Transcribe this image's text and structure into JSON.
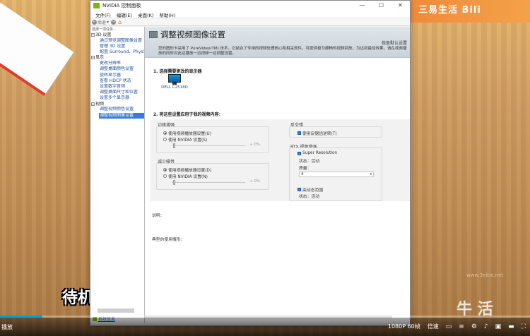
{
  "video": {
    "channel_logo": "三易生活 Bili",
    "subtitle": "待机",
    "watermark": "牛 活",
    "watermark_url": "www.3eitie.net",
    "progress_fraction": 0.08,
    "left_label": "播放",
    "quality": "1080P 60帧",
    "speed": "倍速",
    "icons": [
      "subtitle-icon",
      "danmaku-icon",
      "settings-icon",
      "volume-icon",
      "pip-icon",
      "widescreen-icon",
      "fullscreen-icon"
    ]
  },
  "window": {
    "title": "NVIDIA 控制面板",
    "buttons": [
      "—",
      "☐",
      "✕"
    ],
    "menu": [
      "文件(F)",
      "编辑(E)",
      "桌面(K)",
      "帮助(H)"
    ],
    "toolbar": {
      "back": "后退",
      "forward": "→",
      "home": "⌂"
    }
  },
  "tree": {
    "header": "选择一项任务...",
    "categories": [
      {
        "label": "3D 设置",
        "items": [
          "通过预览调整图像设置",
          "管理 3D 设置",
          "配置 Surround、PhysX"
        ]
      },
      {
        "label": "显示",
        "items": [
          "更改分辨率",
          "调整桌面颜色设置",
          "旋转显示器",
          "查看 HDCP 状态",
          "设置数字音频",
          "调整桌面尺寸和位置",
          "设置多个显示器"
        ]
      },
      {
        "label": "视频",
        "items": [
          "调整视频颜色设置",
          "调整视频图像设置"
        ]
      }
    ],
    "selected": "调整视频图像设置",
    "system_info": "系统信息"
  },
  "content": {
    "title": "调整视频图像设置",
    "restore_defaults": "恢复默认设置",
    "description": "您的图形卡采用了 PureVideo(TM) 技术，它结合了专用的视频处理核心和相关软件，可提供极为顺畅的视频回放，为达到最佳效果，请在视频播放的同时对此边播放一边视频一边调整设置。",
    "section1": "1. 选择需要更改的显示器",
    "monitor_name": "DELL C2518D",
    "section2": "2. 将这些设置应用于我的视频内容：",
    "edge": {
      "title": "边缘增强",
      "option1": "使用视频播放器设置(U)",
      "option2": "使用 NVIDIA 设置(S)",
      "value": "0%"
    },
    "noise": {
      "title": "减少噪音",
      "option1": "使用视频播放器设置(D)",
      "option2": "使用 NVIDIA 设置(N)",
      "value": "0%"
    },
    "deinterlace": {
      "title": "反交错",
      "option": "使用反锯齿逆转(T)"
    },
    "rtx": {
      "title": "RTX 视频增强",
      "super_res": "Super Resolution",
      "super_status": "状态：活动",
      "quality_label": "质量：",
      "quality_value": "4",
      "hdr": "高动态范围",
      "hdr_status": "状态：活动"
    },
    "explain_label": "说明：",
    "usage_label": "典型的使用情形："
  }
}
